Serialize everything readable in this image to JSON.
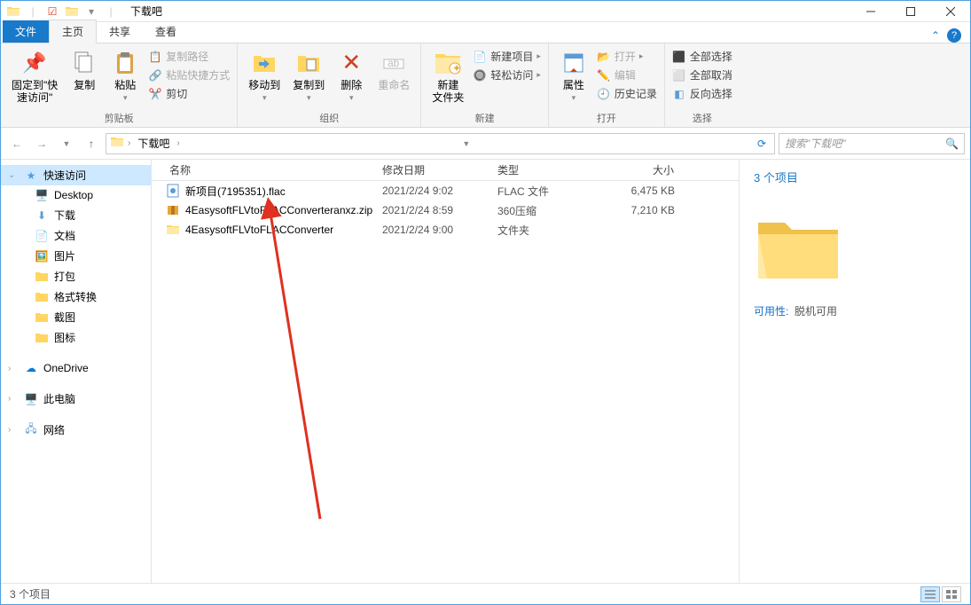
{
  "window": {
    "title": "下载吧"
  },
  "tabs": {
    "file": "文件",
    "home": "主页",
    "share": "共享",
    "view": "查看"
  },
  "ribbon": {
    "clipboard": {
      "pin": "固定到\"快\n速访问\"",
      "copy": "复制",
      "paste": "粘贴",
      "copypath": "复制路径",
      "pasteshortcut": "粘贴快捷方式",
      "cut": "剪切",
      "label": "剪贴板"
    },
    "organize": {
      "moveto": "移动到",
      "copyto": "复制到",
      "delete": "删除",
      "rename": "重命名",
      "label": "组织"
    },
    "new": {
      "newfolder": "新建\n文件夹",
      "newitem": "新建项目",
      "easyaccess": "轻松访问",
      "label": "新建"
    },
    "open": {
      "properties": "属性",
      "open": "打开",
      "edit": "编辑",
      "history": "历史记录",
      "label": "打开"
    },
    "select": {
      "selectall": "全部选择",
      "selectnone": "全部取消",
      "invert": "反向选择",
      "label": "选择"
    }
  },
  "address": {
    "root": "下载吧"
  },
  "search": {
    "placeholder": "搜索\"下载吧\""
  },
  "nav": {
    "quickaccess": "快速访问",
    "items": [
      "Desktop",
      "下载",
      "文档",
      "图片",
      "打包",
      "格式转换",
      "截图",
      "图标"
    ],
    "onedrive": "OneDrive",
    "thispc": "此电脑",
    "network": "网络"
  },
  "columns": {
    "name": "名称",
    "date": "修改日期",
    "type": "类型",
    "size": "大小"
  },
  "files": [
    {
      "icon": "flac",
      "name": "新项目(7195351).flac",
      "date": "2021/2/24 9:02",
      "type": "FLAC 文件",
      "size": "6,475 KB"
    },
    {
      "icon": "zip",
      "name": "4EasysoftFLVtoFLACConverteranxz.zip",
      "date": "2021/2/24 8:59",
      "type": "360压缩",
      "size": "7,210 KB"
    },
    {
      "icon": "folder",
      "name": "4EasysoftFLVtoFLACConverter",
      "date": "2021/2/24 9:00",
      "type": "文件夹",
      "size": ""
    }
  ],
  "preview": {
    "count": "3 个项目",
    "avail_k": "可用性:",
    "avail_v": "脱机可用"
  },
  "status": {
    "text": "3 个项目"
  }
}
